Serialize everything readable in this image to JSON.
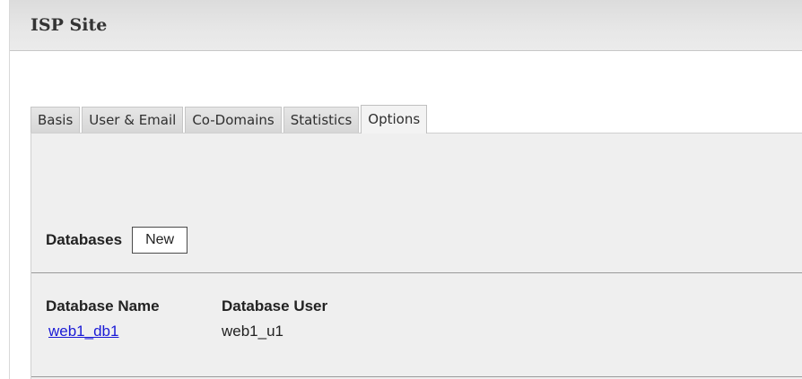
{
  "window": {
    "title": "ISP Site"
  },
  "tabs": [
    {
      "label": "Basis",
      "active": false
    },
    {
      "label": "User & Email",
      "active": false
    },
    {
      "label": "Co-Domains",
      "active": false
    },
    {
      "label": "Statistics",
      "active": false
    },
    {
      "label": "Options",
      "active": true
    }
  ],
  "databases": {
    "section_label": "Databases",
    "new_button_label": "New",
    "columns": [
      "Database Name",
      "Database User"
    ],
    "rows": [
      {
        "name": "web1_db1",
        "user": "web1_u1"
      }
    ]
  }
}
